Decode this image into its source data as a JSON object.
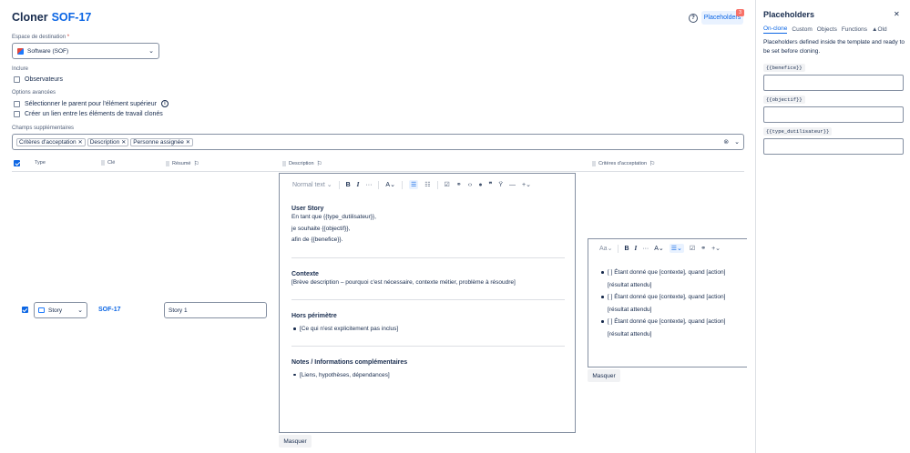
{
  "title": {
    "prefix": "Cloner",
    "key": "SOF-17"
  },
  "header": {
    "help_icon": "?",
    "placeholders_btn": "Placeholders",
    "badge": "3"
  },
  "destination": {
    "label": "Espace de destination",
    "required": "*",
    "value": "Software (SOF)"
  },
  "include": {
    "label": "Inclure",
    "observers": "Observateurs"
  },
  "advanced": {
    "label": "Options avancées",
    "select_parent": "Sélectionner le parent pour l'élément supérieur",
    "info_icon": "i",
    "create_link": "Créer un lien entre les éléments de travail clonés"
  },
  "extra_fields": {
    "label": "Champs supplémentaires",
    "chips": [
      "Critères d'acceptation",
      "Description",
      "Personne assignée"
    ]
  },
  "table": {
    "headers": {
      "type": "Type",
      "key": "Clé",
      "summary": "Résumé",
      "description": "Description",
      "criteria": "Critères d'acceptation"
    },
    "row": {
      "type": "Story",
      "key": "SOF-17",
      "summary": "Story 1"
    }
  },
  "editor": {
    "normal_text": "Normal text",
    "us_heading": "User Story",
    "us_line1": "En tant que {{type_dutilisateur}},",
    "us_line2": "je souhaite {{objectif}},",
    "us_line3": "afin de {{benefice}}.",
    "ctx_heading": "Contexte",
    "ctx_body": "[Brève description – pourquoi c'est nécessaire, contexte métier, problème à résoudre]",
    "out_heading": "Hors périmètre",
    "out_item": "[Ce qui n'est explicitement pas inclus]",
    "notes_heading": "Notes / Informations complémentaires",
    "notes_item": "[Liens, hypothèses, dépendances]",
    "hide": "Masquer"
  },
  "criteria_editor": {
    "font": "Aa",
    "items": [
      {
        "l1": "[ ] Étant donné que [contexte], quand [action]",
        "l2": "[résultat attendu]"
      },
      {
        "l1": "[ ] Étant donné que [contexte], quand [action]",
        "l2": "[résultat attendu]"
      },
      {
        "l1": "[ ] Étant donné que [contexte], quand [action]",
        "l2": "[résultat attendu]"
      }
    ],
    "hide": "Masquer"
  },
  "panel": {
    "title": "Placeholders",
    "close": "✕",
    "tabs": [
      "On-clone",
      "Custom",
      "Objects",
      "Functions",
      "Old"
    ],
    "desc": "Placeholders defined inside the template and ready to be set before cloning.",
    "items": [
      "{{benefice}}",
      "{{objectif}}",
      "{{type_dutilisateur}}"
    ]
  }
}
